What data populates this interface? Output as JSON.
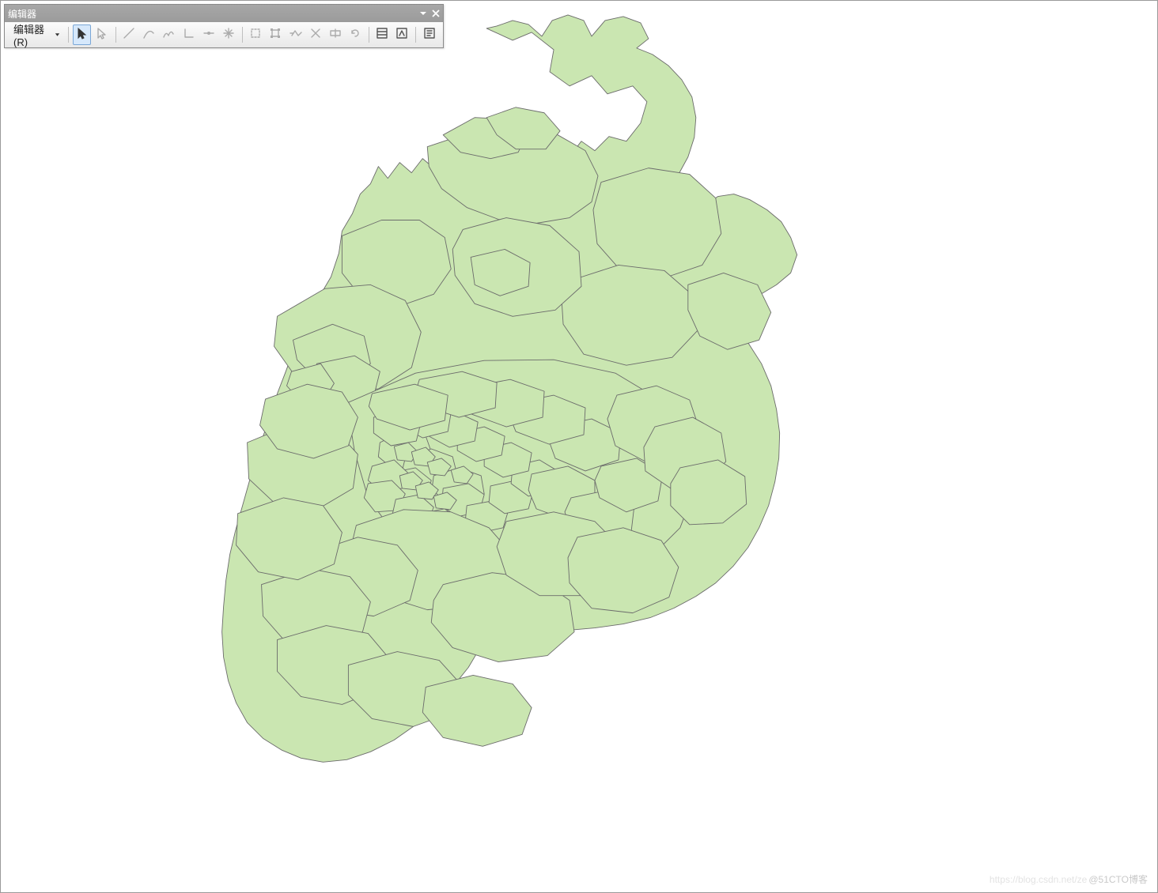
{
  "toolbar": {
    "title": "编辑器",
    "menu_label": "编辑器(R)",
    "tools": [
      {
        "name": "edit-tool",
        "icon": "pointer-solid",
        "active": true,
        "enabled": true
      },
      {
        "name": "edit-annotation-tool",
        "icon": "pointer-outline",
        "active": false,
        "enabled": false
      },
      {
        "name": "sep"
      },
      {
        "name": "straight-segment",
        "icon": "line",
        "active": false,
        "enabled": false
      },
      {
        "name": "end-point-arc",
        "icon": "arc",
        "active": false,
        "enabled": false
      },
      {
        "name": "trace",
        "icon": "trace",
        "active": false,
        "enabled": false
      },
      {
        "name": "right-angle",
        "icon": "right-angle",
        "active": false,
        "enabled": false
      },
      {
        "name": "midpoint",
        "icon": "midpoint",
        "active": false,
        "enabled": false
      },
      {
        "name": "distance-distance",
        "icon": "burst",
        "active": false,
        "enabled": false
      },
      {
        "name": "sep"
      },
      {
        "name": "point",
        "icon": "rect-dash",
        "active": false,
        "enabled": false
      },
      {
        "name": "edit-vertices",
        "icon": "rect-nodes",
        "active": false,
        "enabled": false
      },
      {
        "name": "reshape-feature",
        "icon": "reshape",
        "active": false,
        "enabled": false
      },
      {
        "name": "cut-polygons",
        "icon": "cut",
        "active": false,
        "enabled": false
      },
      {
        "name": "split-tool",
        "icon": "split",
        "active": false,
        "enabled": false
      },
      {
        "name": "rotate-tool",
        "icon": "rotate",
        "active": false,
        "enabled": false
      },
      {
        "name": "sep"
      },
      {
        "name": "attributes",
        "icon": "attributes",
        "active": false,
        "enabled": true
      },
      {
        "name": "sketch-properties",
        "icon": "sketch-props",
        "active": false,
        "enabled": true
      },
      {
        "name": "sep"
      },
      {
        "name": "create-features",
        "icon": "create-features",
        "active": false,
        "enabled": true
      }
    ]
  },
  "map": {
    "fill_color": "#cae6b1",
    "stroke_color": "#6b6b6b",
    "stroke_width": 0.9,
    "description": "Polygon feature layer — administrative subdivisions (city districts/barrios) rendered with single-symbol light green fill in ArcMap data view."
  },
  "watermark": {
    "faint": "https://blog.csdn.net/ze",
    "text": "@51CTO博客"
  }
}
